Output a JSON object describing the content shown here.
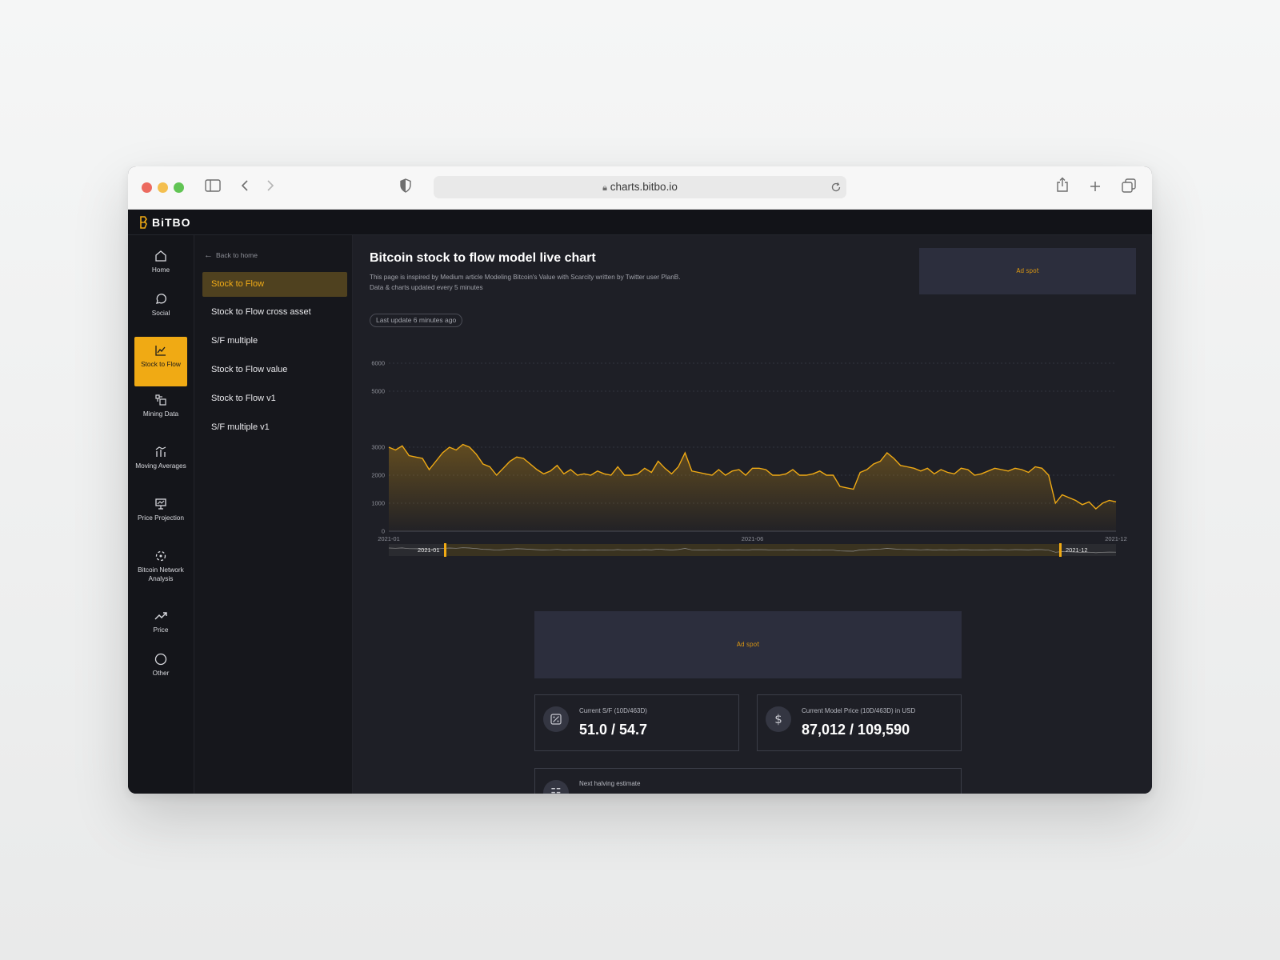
{
  "browser": {
    "url": "charts.bitbo.io",
    "traffic_lights": [
      "#ec6a5f",
      "#f4bf4f",
      "#61c454"
    ]
  },
  "app": {
    "brand": "BiTBO",
    "accent": "#f0aa14"
  },
  "rail": {
    "items": [
      {
        "label": "Home",
        "icon": "home-icon",
        "active": false
      },
      {
        "label": "Social",
        "icon": "chat-bubble-icon",
        "active": false
      },
      {
        "label": "Stock to Flow",
        "icon": "line-chart-icon",
        "active": true
      },
      {
        "label": "Mining Data",
        "icon": "mining-icon",
        "active": false
      },
      {
        "label": "Moving Averages",
        "icon": "moving-averages-icon",
        "active": false
      },
      {
        "label": "Price Projection",
        "icon": "presentation-chart-icon",
        "active": false
      },
      {
        "label": "Bitcoin Network Analysis",
        "icon": "network-icon",
        "active": false
      },
      {
        "label": "Price",
        "icon": "trending-up-icon",
        "active": false
      },
      {
        "label": "Other",
        "icon": "circle-icon",
        "active": false
      }
    ]
  },
  "subnav": {
    "back_label": "Back to home",
    "items": [
      {
        "label": "Stock to Flow",
        "active": true
      },
      {
        "label": "Stock to Flow cross asset",
        "active": false
      },
      {
        "label": "S/F multiple",
        "active": false
      },
      {
        "label": "Stock to Flow value",
        "active": false
      },
      {
        "label": "Stock to Flow v1",
        "active": false
      },
      {
        "label": "S/F multiple v1",
        "active": false
      }
    ]
  },
  "main": {
    "title": "Bitcoin stock to flow model live chart",
    "description_line1": "This page is inspired by Medium article Modeling Bitcoin's Value with Scarcity written by Twitter user PlanB.",
    "description_line2": "Data & charts updated every 5 minutes",
    "ad_top": "Ad spot",
    "last_update": "Last update 6 minutes ago",
    "ad_mid": "Ad spot",
    "stats": [
      {
        "label": "Current S/F (10D/463D)",
        "value": "51.0 / 54.7",
        "icon": "sf-ratio-icon"
      },
      {
        "label": "Current Model Price (10D/463D) in USD",
        "value": "87,012 / 109,590",
        "icon": "dollar-icon"
      }
    ],
    "halving_label": "Next halving estimate"
  },
  "chart_data": {
    "type": "area",
    "ylim": [
      0,
      6000
    ],
    "yticks": [
      0,
      1000,
      2000,
      3000,
      5000,
      6000
    ],
    "xticks": [
      "2021-01",
      "2021-06",
      "2021-12"
    ],
    "navigator_labels": [
      "2021-01",
      "2021-12"
    ],
    "grid": true,
    "line_color": "#f0aa14",
    "series": [
      {
        "values": [
          3000,
          2900,
          3050,
          2700,
          2650,
          2600,
          2200,
          2500,
          2800,
          3000,
          2900,
          3100,
          3000,
          2750,
          2400,
          2300,
          2000,
          2250,
          2500,
          2650,
          2600,
          2400,
          2200,
          2050,
          2150,
          2350,
          2050,
          2200,
          2000,
          2050,
          2000,
          2150,
          2050,
          2000,
          2300,
          2000,
          2000,
          2050,
          2250,
          2100,
          2500,
          2250,
          2050,
          2300,
          2800,
          2150,
          2100,
          2050,
          2000,
          2200,
          2000,
          2150,
          2200,
          2000,
          2250,
          2250,
          2200,
          2000,
          2000,
          2050,
          2200,
          2000,
          2000,
          2050,
          2150,
          2000,
          2000,
          1600,
          1550,
          1500,
          2100,
          2200,
          2400,
          2500,
          2800,
          2600,
          2350,
          2300,
          2250,
          2150,
          2250,
          2050,
          2200,
          2100,
          2050,
          2250,
          2200,
          2000,
          2050,
          2150,
          2250,
          2200,
          2150,
          2250,
          2200,
          2100,
          2300,
          2250,
          2000,
          1000,
          1300,
          1200,
          1100,
          950,
          1050,
          800,
          1000,
          1100,
          1050
        ]
      }
    ]
  }
}
